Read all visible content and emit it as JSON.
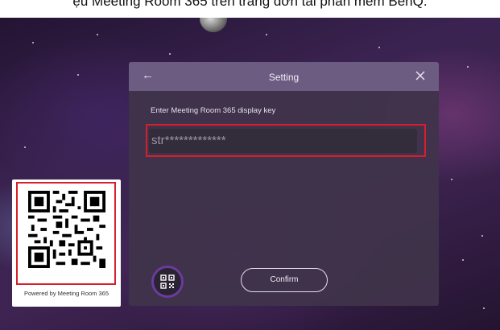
{
  "caption": {
    "text": "ệu Meeting Room 365 trên trang đơn tải phần mềm BenQ."
  },
  "dialog": {
    "title": "Setting",
    "back_icon": "arrow-left-icon",
    "close_icon": "close-icon",
    "field_label": "Enter Meeting Room 365 display key",
    "key_value": "str*************",
    "confirm_label": "Confirm",
    "qr_toggle_icon": "qr-code-icon"
  },
  "qr_card": {
    "caption": "Powered by Meeting Room 365"
  },
  "colors": {
    "highlight": "#d71e2b",
    "header": "#76648c",
    "dialog_bg": "#40344a",
    "qr_ring": "#6b3b9c"
  }
}
